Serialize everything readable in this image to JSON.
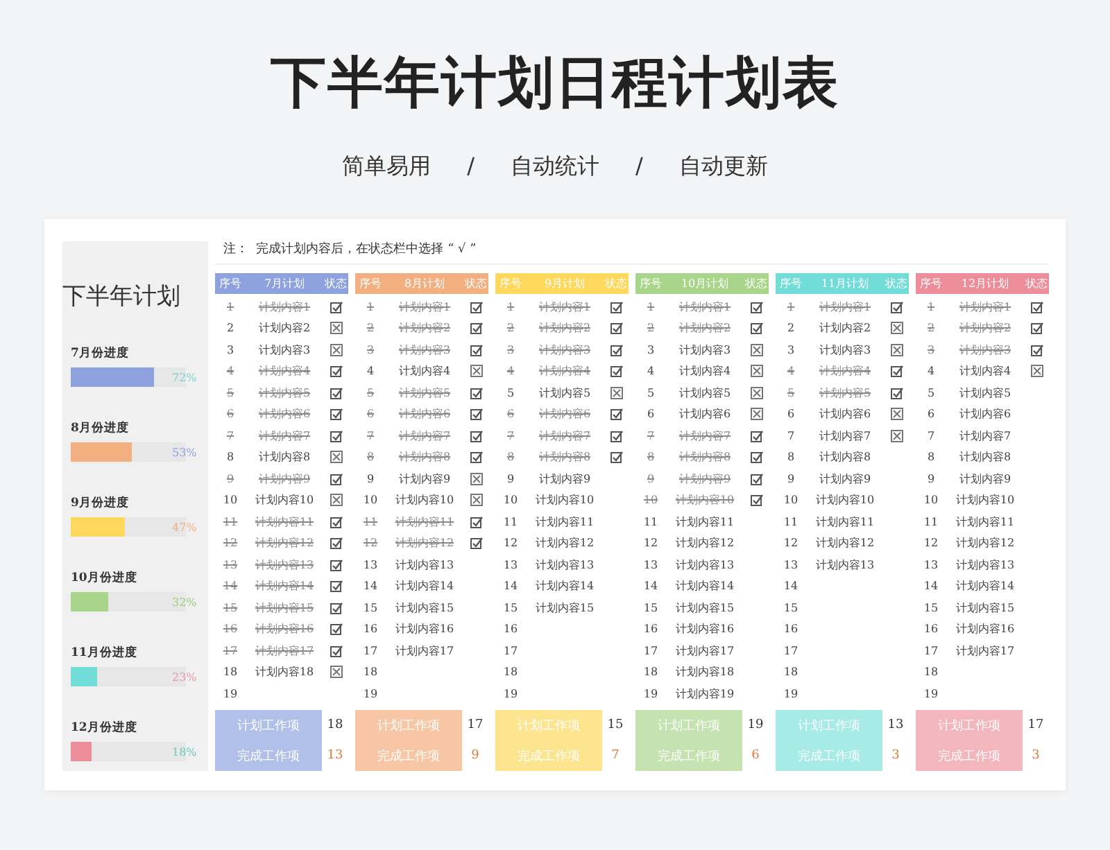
{
  "title": "下半年计划日程计划表",
  "features": [
    "简单易用",
    "自动统计",
    "自动更新"
  ],
  "separator": "/",
  "sidebar": {
    "title": "下半年计划",
    "progress": [
      {
        "label": "7月份进度",
        "level": 0.72,
        "color": "#8da2dc",
        "reading": {
          "text": "72%",
          "color": "#7fd3d0"
        }
      },
      {
        "label": "8月份进度",
        "level": 0.53,
        "color": "#f2b080",
        "reading": {
          "text": "53%",
          "color": "#8da2dc"
        }
      },
      {
        "label": "9月份进度",
        "level": 0.47,
        "color": "#fdd85d",
        "reading": {
          "text": "47%",
          "color": "#f2b080"
        }
      },
      {
        "label": "10月份进度",
        "level": 0.32,
        "color": "#a8d58a",
        "reading": {
          "text": "32%",
          "color": "#9ccc7e"
        }
      },
      {
        "label": "11月份进度",
        "level": 0.23,
        "color": "#72ddd8",
        "reading": {
          "text": "23%",
          "color": "#ee9aa6"
        }
      },
      {
        "label": "12月份进度",
        "level": 0.18,
        "color": "#ee8d9a",
        "reading": {
          "text": "18%",
          "color": "#6fc9b8"
        }
      }
    ]
  },
  "note": "注：  完成计划内容后，在状态栏中选择 “ √ ”",
  "months": [
    {
      "color": "#8da2dc",
      "columns": [
        "序号",
        "7月计划",
        "状态"
      ],
      "summary": {
        "color": "#b1c0e8",
        "planned_label": "计划工作项",
        "planned": "18",
        "done_label": "完成工作项",
        "done": "13"
      },
      "rows": [
        {
          "no": "1",
          "item": "计划内容1",
          "kind": "done"
        },
        {
          "no": "2",
          "item": "计划内容2",
          "kind": "open"
        },
        {
          "no": "3",
          "item": "计划内容3",
          "kind": "open"
        },
        {
          "no": "4",
          "item": "计划内容4",
          "kind": "done"
        },
        {
          "no": "5",
          "item": "计划内容5",
          "kind": "done"
        },
        {
          "no": "6",
          "item": "计划内容6",
          "kind": "done"
        },
        {
          "no": "7",
          "item": "计划内容7",
          "kind": "done"
        },
        {
          "no": "8",
          "item": "计划内容8",
          "kind": "open"
        },
        {
          "no": "9",
          "item": "计划内容9",
          "kind": "done"
        },
        {
          "no": "10",
          "item": "计划内容10",
          "kind": "open"
        },
        {
          "no": "11",
          "item": "计划内容11",
          "kind": "done"
        },
        {
          "no": "12",
          "item": "计划内容12",
          "kind": "done"
        },
        {
          "no": "13",
          "item": "计划内容13",
          "kind": "done"
        },
        {
          "no": "14",
          "item": "计划内容14",
          "kind": "done"
        },
        {
          "no": "15",
          "item": "计划内容15",
          "kind": "done"
        },
        {
          "no": "16",
          "item": "计划内容16",
          "kind": "done"
        },
        {
          "no": "17",
          "item": "计划内容17",
          "kind": "done"
        },
        {
          "no": "18",
          "item": "计划内容18",
          "kind": "open"
        },
        {
          "no": "19",
          "kind": "blank"
        }
      ]
    },
    {
      "color": "#f2b080",
      "columns": [
        "序号",
        "8月计划",
        "状态"
      ],
      "summary": {
        "color": "#f7c6a4",
        "planned_label": "计划工作项",
        "planned": "17",
        "done_label": "完成工作项",
        "done": "9"
      },
      "rows": [
        {
          "no": "1",
          "item": "计划内容1",
          "kind": "done"
        },
        {
          "no": "2",
          "item": "计划内容2",
          "kind": "done"
        },
        {
          "no": "3",
          "item": "计划内容3",
          "kind": "done"
        },
        {
          "no": "4",
          "item": "计划内容4",
          "kind": "open"
        },
        {
          "no": "5",
          "item": "计划内容5",
          "kind": "done"
        },
        {
          "no": "6",
          "item": "计划内容6",
          "kind": "done"
        },
        {
          "no": "7",
          "item": "计划内容7",
          "kind": "done"
        },
        {
          "no": "8",
          "item": "计划内容8",
          "kind": "done"
        },
        {
          "no": "9",
          "item": "计划内容9",
          "kind": "open"
        },
        {
          "no": "10",
          "item": "计划内容10",
          "kind": "open"
        },
        {
          "no": "11",
          "item": "计划内容11",
          "kind": "done"
        },
        {
          "no": "12",
          "item": "计划内容12",
          "kind": "done"
        },
        {
          "no": "13",
          "item": "计划内容13",
          "kind": "blank"
        },
        {
          "no": "14",
          "item": "计划内容14",
          "kind": "blank"
        },
        {
          "no": "15",
          "item": "计划内容15",
          "kind": "blank"
        },
        {
          "no": "16",
          "item": "计划内容16",
          "kind": "blank"
        },
        {
          "no": "17",
          "item": "计划内容17",
          "kind": "blank"
        },
        {
          "no": "18",
          "kind": "blank"
        },
        {
          "no": "19",
          "kind": "blank"
        }
      ]
    },
    {
      "color": "#fdd85d",
      "columns": [
        "序号",
        "9月计划",
        "状态"
      ],
      "summary": {
        "color": "#fde58f",
        "planned_label": "计划工作项",
        "planned": "15",
        "done_label": "完成工作项",
        "done": "7"
      },
      "rows": [
        {
          "no": "1",
          "item": "计划内容1",
          "kind": "done"
        },
        {
          "no": "2",
          "item": "计划内容2",
          "kind": "done"
        },
        {
          "no": "3",
          "item": "计划内容3",
          "kind": "done"
        },
        {
          "no": "4",
          "item": "计划内容4",
          "kind": "done"
        },
        {
          "no": "5",
          "item": "计划内容5",
          "kind": "open"
        },
        {
          "no": "6",
          "item": "计划内容6",
          "kind": "done"
        },
        {
          "no": "7",
          "item": "计划内容7",
          "kind": "done"
        },
        {
          "no": "8",
          "item": "计划内容8",
          "kind": "done"
        },
        {
          "no": "9",
          "item": "计划内容9",
          "kind": "blank"
        },
        {
          "no": "10",
          "item": "计划内容10",
          "kind": "blank"
        },
        {
          "no": "11",
          "item": "计划内容11",
          "kind": "blank"
        },
        {
          "no": "12",
          "item": "计划内容12",
          "kind": "blank"
        },
        {
          "no": "13",
          "item": "计划内容13",
          "kind": "blank"
        },
        {
          "no": "14",
          "item": "计划内容14",
          "kind": "blank"
        },
        {
          "no": "15",
          "item": "计划内容15",
          "kind": "blank"
        },
        {
          "no": "16",
          "kind": "blank"
        },
        {
          "no": "17",
          "kind": "blank"
        },
        {
          "no": "18",
          "kind": "blank"
        },
        {
          "no": "19",
          "kind": "blank"
        }
      ]
    },
    {
      "color": "#a8d58a",
      "columns": [
        "序号",
        "10月计划",
        "状态"
      ],
      "summary": {
        "color": "#c5e3b0",
        "planned_label": "计划工作项",
        "planned": "19",
        "done_label": "完成工作项",
        "done": "6"
      },
      "rows": [
        {
          "no": "1",
          "item": "计划内容1",
          "kind": "done"
        },
        {
          "no": "2",
          "item": "计划内容2",
          "kind": "done"
        },
        {
          "no": "3",
          "item": "计划内容3",
          "kind": "open"
        },
        {
          "no": "4",
          "item": "计划内容4",
          "kind": "open"
        },
        {
          "no": "5",
          "item": "计划内容5",
          "kind": "open"
        },
        {
          "no": "6",
          "item": "计划内容6",
          "kind": "open"
        },
        {
          "no": "7",
          "item": "计划内容7",
          "kind": "done"
        },
        {
          "no": "8",
          "item": "计划内容8",
          "kind": "done"
        },
        {
          "no": "9",
          "item": "计划内容9",
          "kind": "done"
        },
        {
          "no": "10",
          "item": "计划内容10",
          "kind": "done"
        },
        {
          "no": "11",
          "item": "计划内容11",
          "kind": "blank"
        },
        {
          "no": "12",
          "item": "计划内容12",
          "kind": "blank"
        },
        {
          "no": "13",
          "item": "计划内容13",
          "kind": "blank"
        },
        {
          "no": "14",
          "item": "计划内容14",
          "kind": "blank"
        },
        {
          "no": "15",
          "item": "计划内容15",
          "kind": "blank"
        },
        {
          "no": "16",
          "item": "计划内容16",
          "kind": "blank"
        },
        {
          "no": "17",
          "item": "计划内容17",
          "kind": "blank"
        },
        {
          "no": "18",
          "item": "计划内容18",
          "kind": "blank"
        },
        {
          "no": "19",
          "item": "计划内容19",
          "kind": "blank"
        }
      ]
    },
    {
      "color": "#72ddd8",
      "columns": [
        "序号",
        "11月计划",
        "状态"
      ],
      "summary": {
        "color": "#a6ebe6",
        "planned_label": "计划工作项",
        "planned": "13",
        "done_label": "完成工作项",
        "done": "3"
      },
      "rows": [
        {
          "no": "1",
          "item": "计划内容1",
          "kind": "done"
        },
        {
          "no": "2",
          "item": "计划内容2",
          "kind": "open"
        },
        {
          "no": "3",
          "item": "计划内容3",
          "kind": "open"
        },
        {
          "no": "4",
          "item": "计划内容4",
          "kind": "done"
        },
        {
          "no": "5",
          "item": "计划内容5",
          "kind": "done"
        },
        {
          "no": "6",
          "item": "计划内容6",
          "kind": "open"
        },
        {
          "no": "7",
          "item": "计划内容7",
          "kind": "open"
        },
        {
          "no": "8",
          "item": "计划内容8",
          "kind": "blank"
        },
        {
          "no": "9",
          "item": "计划内容9",
          "kind": "blank"
        },
        {
          "no": "10",
          "item": "计划内容10",
          "kind": "blank"
        },
        {
          "no": "11",
          "item": "计划内容11",
          "kind": "blank"
        },
        {
          "no": "12",
          "item": "计划内容12",
          "kind": "blank"
        },
        {
          "no": "13",
          "item": "计划内容13",
          "kind": "blank"
        },
        {
          "no": "14",
          "kind": "blank"
        },
        {
          "no": "15",
          "kind": "blank"
        },
        {
          "no": "16",
          "kind": "blank"
        },
        {
          "no": "17",
          "kind": "blank"
        },
        {
          "no": "18",
          "kind": "blank"
        },
        {
          "no": "19",
          "kind": "blank"
        }
      ]
    },
    {
      "color": "#ee8d9a",
      "columns": [
        "序号",
        "12月计划",
        "状态"
      ],
      "summary": {
        "color": "#f3b6bd",
        "planned_label": "计划工作项",
        "planned": "17",
        "done_label": "完成工作项",
        "done": "3"
      },
      "rows": [
        {
          "no": "1",
          "item": "计划内容1",
          "kind": "done"
        },
        {
          "no": "2",
          "item": "计划内容2",
          "kind": "done"
        },
        {
          "no": "3",
          "item": "计划内容3",
          "kind": "done"
        },
        {
          "no": "4",
          "item": "计划内容4",
          "kind": "open"
        },
        {
          "no": "5",
          "item": "计划内容5",
          "kind": "blank"
        },
        {
          "no": "6",
          "item": "计划内容6",
          "kind": "blank"
        },
        {
          "no": "7",
          "item": "计划内容7",
          "kind": "blank"
        },
        {
          "no": "8",
          "item": "计划内容8",
          "kind": "blank"
        },
        {
          "no": "9",
          "item": "计划内容9",
          "kind": "blank"
        },
        {
          "no": "10",
          "item": "计划内容10",
          "kind": "blank"
        },
        {
          "no": "11",
          "item": "计划内容11",
          "kind": "blank"
        },
        {
          "no": "12",
          "item": "计划内容12",
          "kind": "blank"
        },
        {
          "no": "13",
          "item": "计划内容13",
          "kind": "blank"
        },
        {
          "no": "14",
          "item": "计划内容14",
          "kind": "blank"
        },
        {
          "no": "15",
          "item": "计划内容15",
          "kind": "blank"
        },
        {
          "no": "16",
          "item": "计划内容16",
          "kind": "blank"
        },
        {
          "no": "17",
          "item": "计划内容17",
          "kind": "blank"
        },
        {
          "no": "18",
          "kind": "blank"
        },
        {
          "no": "19",
          "kind": "blank"
        }
      ]
    }
  ]
}
